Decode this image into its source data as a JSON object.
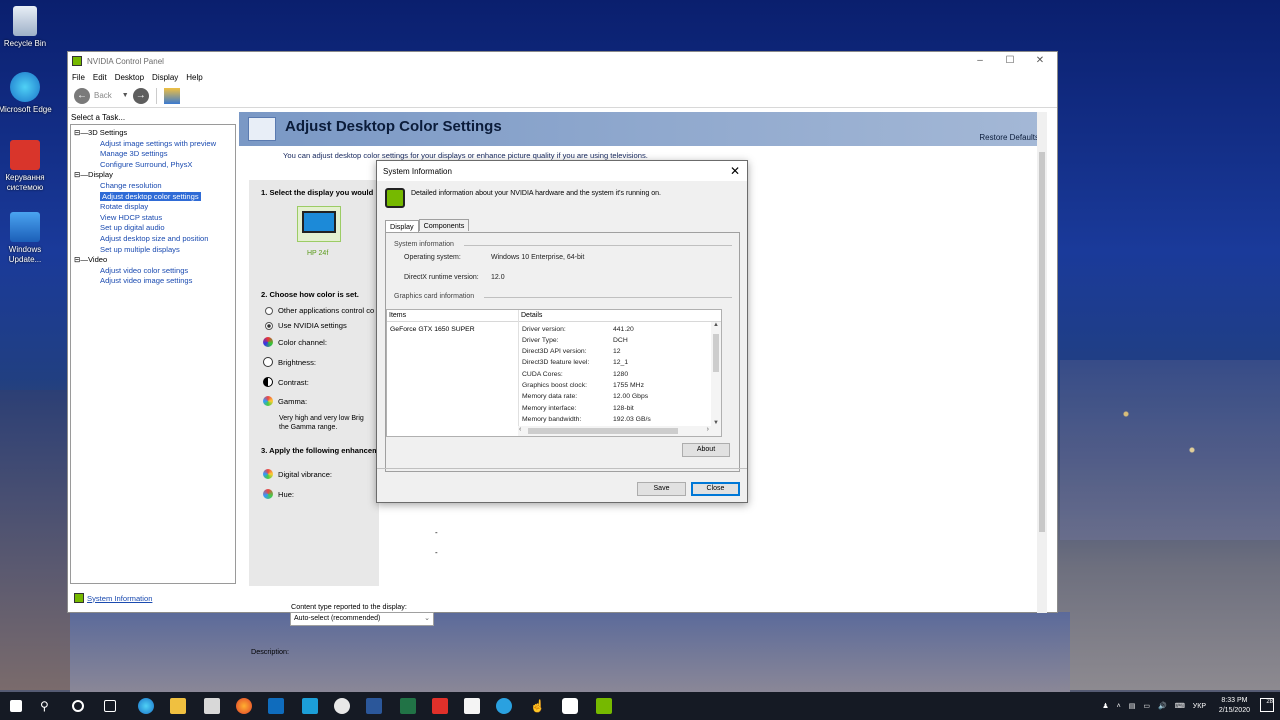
{
  "desktop": {
    "icons": [
      {
        "label": "Recycle Bin"
      },
      {
        "label": "Microsoft Edge"
      },
      {
        "label": "Керування системою"
      },
      {
        "label": "Windows Update..."
      }
    ]
  },
  "window": {
    "title": "NVIDIA Control Panel",
    "menu": [
      "File",
      "Edit",
      "Desktop",
      "Display",
      "Help"
    ],
    "toolbar": {
      "back_label": "Back"
    },
    "task_header": "Select a Task...",
    "tree": [
      {
        "group": "3D Settings",
        "items": [
          "Adjust image settings with preview",
          "Manage 3D settings",
          "Configure Surround, PhysX"
        ]
      },
      {
        "group": "Display",
        "items": [
          "Change resolution",
          "Adjust desktop color settings",
          "Rotate display",
          "View HDCP status",
          "Set up digital audio",
          "Adjust desktop size and position",
          "Set up multiple displays"
        ]
      },
      {
        "group": "Video",
        "items": [
          "Adjust video color settings",
          "Adjust video image settings"
        ]
      }
    ],
    "selected_item": "Adjust desktop color settings",
    "system_info_link": "System Information"
  },
  "page": {
    "title": "Adjust Desktop Color Settings",
    "restore_defaults": "Restore Defaults",
    "description": "You can adjust desktop color settings for your displays or enhance picture quality if you are using televisions.",
    "step1": "1. Select the display you would",
    "display_name": "HP 24f",
    "step2": "2. Choose how color is set.",
    "radio_other": "Other applications control co",
    "radio_nvidia": "Use NVIDIA settings",
    "color_channel": "Color channel:",
    "brightness": "Brightness:",
    "contrast": "Contrast:",
    "gamma": "Gamma:",
    "note": "Very high and very low Brig the Gamma range.",
    "step3": "3. Apply the following enhancem",
    "digital_vibrance": "Digital vibrance:",
    "hue": "Hue:",
    "content_type_label": "Content type reported to the display:",
    "content_type_value": "Auto-select (recommended)",
    "description_label": "Description:",
    "dash": "-"
  },
  "dialog": {
    "title": "System Information",
    "info_text": "Detailed information about your NVIDIA hardware and the system it's running on.",
    "tabs": [
      "Display",
      "Components"
    ],
    "system_info_header": "System information",
    "os_label": "Operating system:",
    "os_value": "Windows 10 Enterprise, 64-bit",
    "dx_label": "DirectX runtime version:",
    "dx_value": "12.0",
    "gfx_header": "Graphics card information",
    "col_items": "Items",
    "col_details": "Details",
    "gpu": "GeForce GTX 1650 SUPER",
    "details": [
      {
        "k": "Driver version:",
        "v": "441.20"
      },
      {
        "k": "Driver Type:",
        "v": "DCH"
      },
      {
        "k": "Direct3D API version:",
        "v": "12"
      },
      {
        "k": "Direct3D feature level:",
        "v": "12_1"
      },
      {
        "k": "CUDA Cores:",
        "v": "1280"
      },
      {
        "k": "Graphics boost clock:",
        "v": "1755 MHz"
      },
      {
        "k": "Memory data rate:",
        "v": "12.00 Gbps"
      },
      {
        "k": "Memory interface:",
        "v": "128-bit"
      },
      {
        "k": "Memory bandwidth:",
        "v": "192.03 GB/s"
      }
    ],
    "about": "About",
    "save": "Save",
    "close": "Close"
  },
  "taskbar": {
    "lang": "УКР",
    "time": "8:33 PM",
    "date": "2/15/2020",
    "notif_count": "28"
  },
  "colors": {
    "nvidia_green": "#76b900",
    "link_blue": "#1b4bb0",
    "banner": "#8aa6cf"
  }
}
